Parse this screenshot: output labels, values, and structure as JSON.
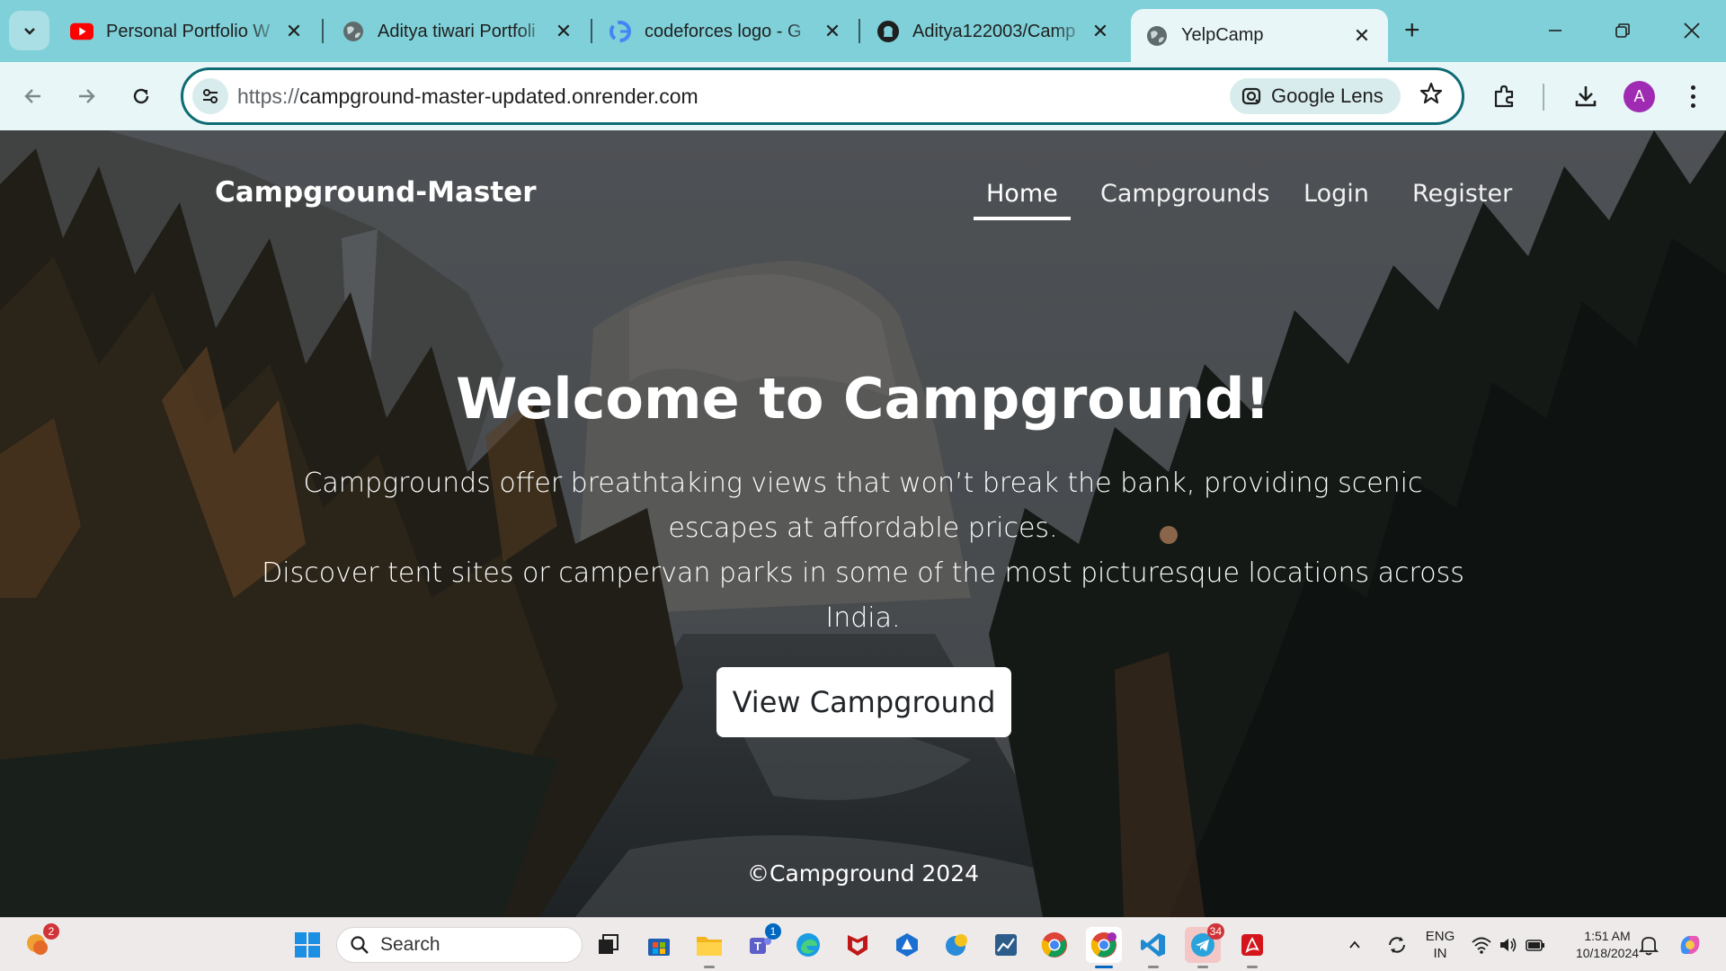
{
  "browser": {
    "tabs": [
      {
        "title": "Personal Portfolio W",
        "icon": "youtube-icon"
      },
      {
        "title": "Aditya tiwari Portfoli",
        "icon": "globe-icon"
      },
      {
        "title": "codeforces logo - G",
        "icon": "google-icon"
      },
      {
        "title": "Aditya122003/Camp",
        "icon": "github-icon"
      },
      {
        "title": "YelpCamp",
        "icon": "globe-icon",
        "active": true
      }
    ],
    "url_scheme": "https://",
    "url_host": "campground-master-updated.onrender.com",
    "lens_label": "Google Lens",
    "profile_initial": "A",
    "accent": "#7fd0d8"
  },
  "site": {
    "brand": "Campground-Master",
    "nav": [
      "Home",
      "Campgrounds",
      "Login",
      "Register"
    ],
    "active_nav": "Home",
    "hero_title": "Welcome to Campground!",
    "hero_line1": "Campgrounds offer breathtaking views that won’t break the bank, providing scenic escapes at affordable prices.",
    "hero_line2": "Discover tent sites or campervan parks in some of the most picturesque locations across India.",
    "cta": "View Campground",
    "footer": "©Campground 2024"
  },
  "taskbar": {
    "search_label": "Search",
    "weather_badge": "2",
    "teams_badge": "1",
    "telegram_badge": "34",
    "lang_line1": "ENG",
    "lang_line2": "IN",
    "time": "1:51 AM",
    "date": "10/18/2024"
  }
}
